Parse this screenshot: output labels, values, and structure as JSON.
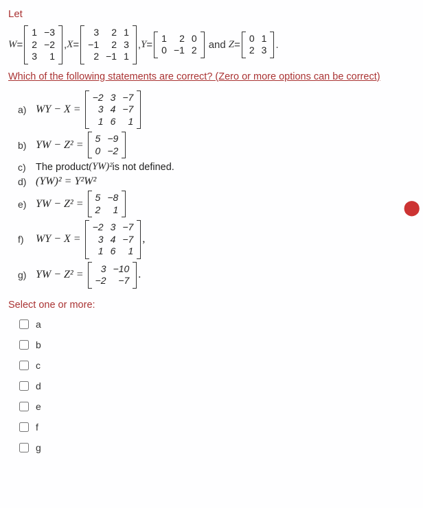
{
  "intro": "Let",
  "matrices_line": {
    "W_label": "W",
    "eq": " = ",
    "W": [
      [
        "1",
        "−3"
      ],
      [
        "2",
        "−2"
      ],
      [
        "3",
        "1"
      ]
    ],
    "comma1": " , ",
    "X_label": "X",
    "X": [
      [
        "3",
        "2",
        "1"
      ],
      [
        "−1",
        "2",
        "3"
      ],
      [
        "2",
        "−1",
        "1"
      ]
    ],
    "comma2": " , ",
    "Y_label": "Y",
    "Y": [
      [
        "1",
        "2",
        "0"
      ],
      [
        "0",
        "−1",
        "2"
      ]
    ],
    "and": " and ",
    "Z_label": "Z",
    "Z": [
      [
        "0",
        "1"
      ],
      [
        "2",
        "3"
      ]
    ],
    "period": "."
  },
  "question": "Which of the following statements are correct? (Zero or more options can be correct)",
  "options": {
    "a": {
      "label": "a)",
      "lhs": "WY − X =",
      "matrix": [
        [
          "−2",
          "3",
          "−7"
        ],
        [
          "3",
          "4",
          "−7"
        ],
        [
          "1",
          "6",
          "1"
        ]
      ]
    },
    "b": {
      "label": "b)",
      "lhs": "YW − Z² =",
      "matrix": [
        [
          "5",
          "−9"
        ],
        [
          "0",
          "−2"
        ]
      ]
    },
    "c": {
      "label": "c)",
      "text_pre": "The product ",
      "expr": "(YW)²",
      "text_post": " is not defined."
    },
    "d": {
      "label": "d)",
      "text": "(YW)² = Y²W²"
    },
    "e": {
      "label": "e)",
      "lhs": "YW − Z² =",
      "matrix": [
        [
          "5",
          "−8"
        ],
        [
          "2",
          "1"
        ]
      ]
    },
    "f": {
      "label": "f)",
      "lhs": "WY − X =",
      "matrix": [
        [
          "−2",
          "3",
          "−7"
        ],
        [
          "3",
          "4",
          "−7"
        ],
        [
          "1",
          "6",
          "1"
        ]
      ],
      "trail": ","
    },
    "g": {
      "label": "g)",
      "lhs": "YW − Z² =",
      "matrix": [
        [
          "3",
          "−10"
        ],
        [
          "−2",
          "−7"
        ]
      ],
      "trail": "."
    }
  },
  "select_label": "Select one or more:",
  "checks": [
    "a",
    "b",
    "c",
    "d",
    "e",
    "f",
    "g"
  ]
}
